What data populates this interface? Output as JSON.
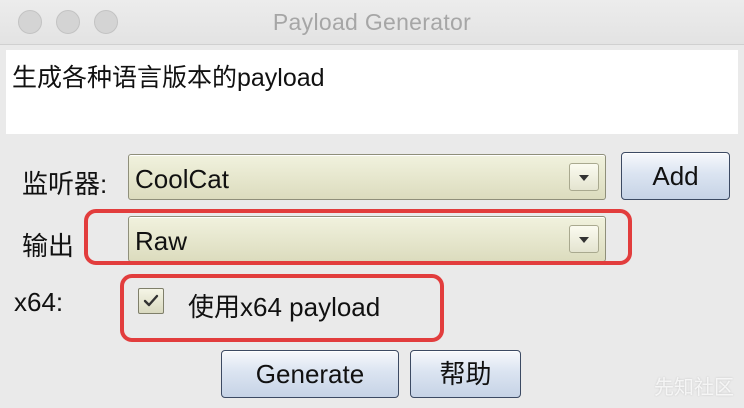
{
  "window": {
    "title": "Payload Generator"
  },
  "description": "生成各种语言版本的payload",
  "listener": {
    "label": "监听器:",
    "selected": "CoolCat",
    "add_label": "Add"
  },
  "output": {
    "label": "输出",
    "selected": "Raw"
  },
  "x64": {
    "label": "x64:",
    "checkbox_label": "使用x64 payload",
    "checked": true
  },
  "actions": {
    "generate_label": "Generate",
    "help_label": "帮助"
  },
  "watermark": "先知社区",
  "colors": {
    "highlight": "#e23d3d",
    "combo_bg": "#e6e6cf",
    "button_bg": "#d3deed"
  }
}
